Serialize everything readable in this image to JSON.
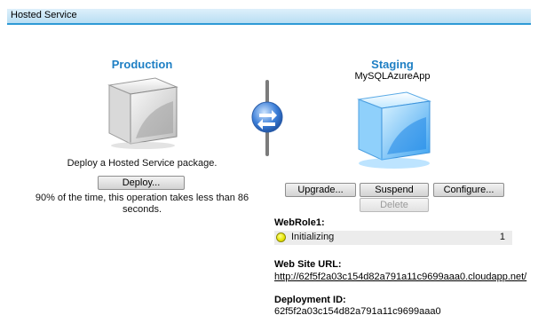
{
  "header": {
    "title": "Hosted Service"
  },
  "production": {
    "title": "Production",
    "description": "Deploy a Hosted Service package.",
    "deploy_label": "Deploy...",
    "note_line1": "90% of the time, this operation takes less than 86",
    "note_line2": "seconds."
  },
  "staging": {
    "title": "Staging",
    "deployment_name": "MySQLAzureApp",
    "buttons": {
      "upgrade": "Upgrade...",
      "suspend": "Suspend",
      "configure": "Configure...",
      "delete": "Delete"
    },
    "role": {
      "label": "WebRole1:",
      "status": "Initializing",
      "count": "1"
    },
    "url": {
      "label": "Web Site URL:",
      "value": "http://62f5f2a03c154d82a791a11c9699aaa0.cloudapp.net/"
    },
    "deployment_id": {
      "label": "Deployment ID:",
      "value": "62f5f2a03c154d82a791a11c9699aaa0"
    }
  },
  "colors": {
    "accent": "#1e7fc4",
    "header_border": "#2e9ad6",
    "status_indicator": "#e7e400"
  }
}
